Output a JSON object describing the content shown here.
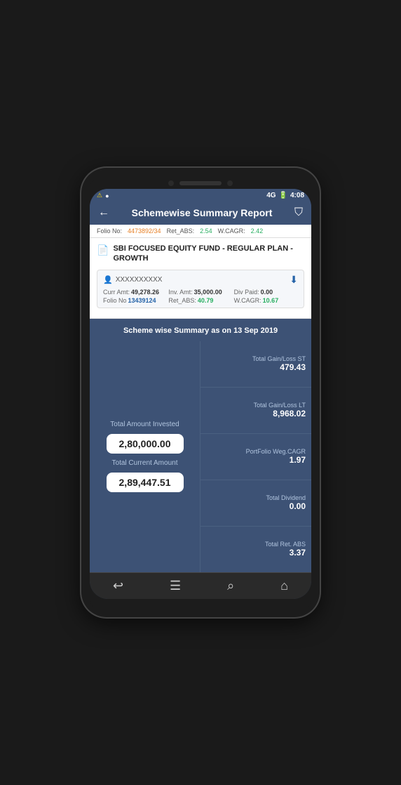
{
  "status_bar": {
    "warn": "⚠",
    "rec": "●",
    "network": "4G",
    "battery": "🔋",
    "time": "4:08"
  },
  "header": {
    "back_label": "←",
    "title": "Schemewise Summary Report",
    "filter_label": "⛉"
  },
  "prev_fund_row": {
    "folio_label": "Folio No:",
    "folio_value": "4473892/34",
    "ret_abs_label": "Ret_ABS:",
    "ret_abs_value": "2.54",
    "wcagr_label": "W.CAGR:",
    "wcagr_value": "2.42"
  },
  "fund": {
    "name": "SBI FOCUSED EQUITY FUND - REGULAR PLAN - GROWTH",
    "account": {
      "id": "XXXXXXXXXX",
      "curr_amt_label": "Curr Amt:",
      "curr_amt_value": "49,278.26",
      "inv_amt_label": "Inv. Amt:",
      "inv_amt_value": "35,000.00",
      "div_paid_label": "Div Paid:",
      "div_paid_value": "0.00",
      "folio_label": "Folio No",
      "folio_value": "13439124",
      "ret_abs_label": "Ret_ABS:",
      "ret_abs_value": "40.79",
      "wcagr_label": "W.CAGR:",
      "wcagr_value": "10.67"
    }
  },
  "summary": {
    "header_text": "Scheme wise Summary as on 13 Sep 2019",
    "total_amount_invested_label": "Total Amount Invested",
    "total_amount_invested_value": "2,80,000.00",
    "total_current_amount_label": "Total Current Amount",
    "total_current_amount_value": "2,89,447.51",
    "right_items": [
      {
        "label": "Total Gain/Loss ST",
        "value": "479.43"
      },
      {
        "label": "Total Gain/Loss LT",
        "value": "8,968.02"
      },
      {
        "label": "PortFolio Weg.CAGR",
        "value": "1.97"
      },
      {
        "label": "Total Dividend",
        "value": "0.00"
      },
      {
        "label": "Total Ret. ABS",
        "value": "3.37"
      }
    ]
  },
  "bottom_nav": {
    "back": "↩",
    "menu": "☰",
    "search": "⌕",
    "home": "⌂"
  }
}
